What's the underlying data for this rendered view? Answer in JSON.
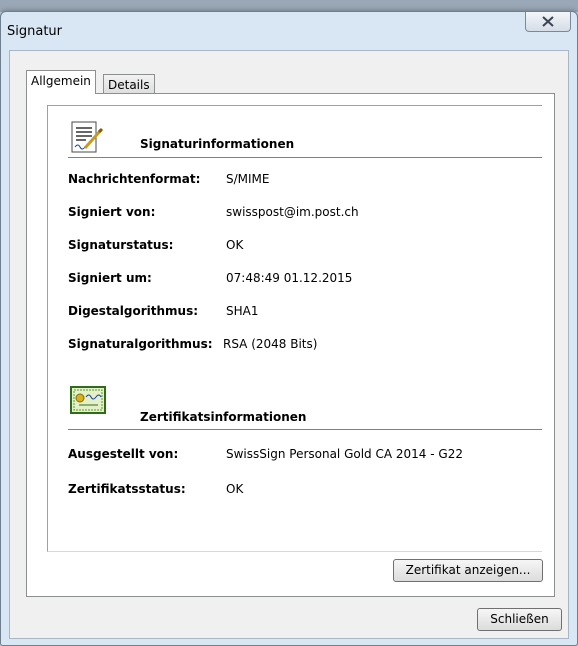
{
  "window": {
    "title": "Signatur"
  },
  "tabs": [
    {
      "label": "Allgemein",
      "active": true
    },
    {
      "label": "Details",
      "active": false
    }
  ],
  "signature_section": {
    "heading": "Signaturinformationen",
    "rows": [
      {
        "label": "Nachrichtenformat:",
        "value": "S/MIME"
      },
      {
        "label": "Signiert von:",
        "value": "swisspost@im.post.ch"
      },
      {
        "label": "Signaturstatus:",
        "value": "OK"
      },
      {
        "label": "Signiert um:",
        "value": "07:48:49 01.12.2015"
      },
      {
        "label": "Digestalgorithmus:",
        "value": "SHA1"
      },
      {
        "label": "Signaturalgorithmus:",
        "value": "RSA (2048 Bits)"
      }
    ]
  },
  "certificate_section": {
    "heading": "Zertifikatsinformationen",
    "rows": [
      {
        "label": "Ausgestellt von:",
        "value": "SwissSign Personal Gold CA 2014 - G22"
      },
      {
        "label": "Zertifikatsstatus:",
        "value": "OK"
      }
    ]
  },
  "buttons": {
    "show_certificate": "Zertifikat anzeigen...",
    "close": "Schließen"
  },
  "icons": {
    "close": "close-icon",
    "signature": "signature-document-icon",
    "certificate": "certificate-icon"
  }
}
